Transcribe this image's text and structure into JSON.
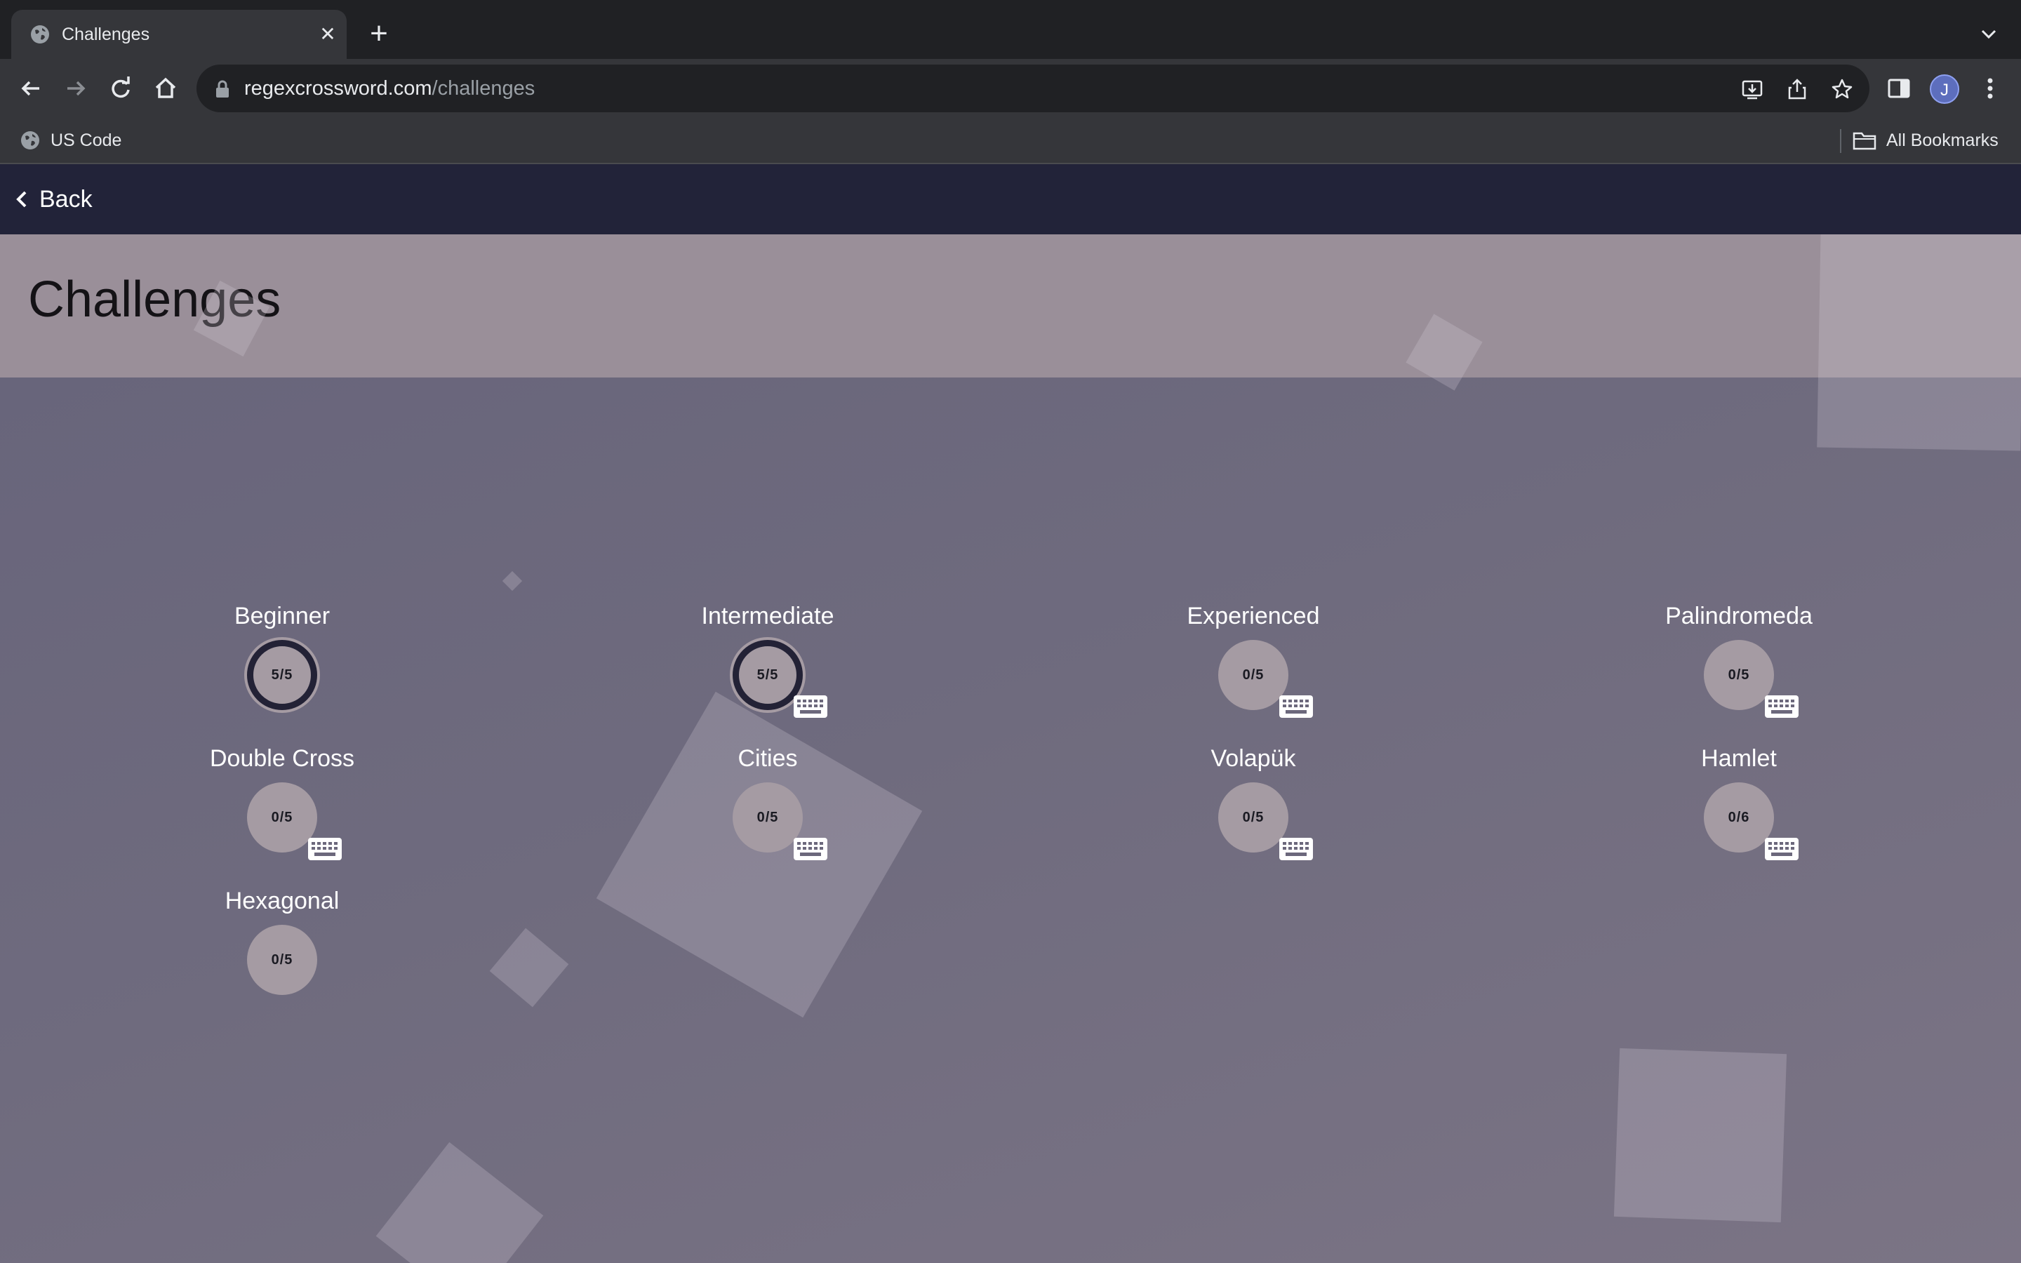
{
  "browser": {
    "tab_title": "Challenges",
    "url_domain": "regexcrossword.com",
    "url_path": "/challenges",
    "profile_initial": "J",
    "bookmarks": {
      "left_item": "US Code",
      "right_item": "All Bookmarks"
    }
  },
  "page": {
    "back_label": "Back",
    "title": "Challenges"
  },
  "challenges": [
    {
      "name": "Beginner",
      "score": "5/5",
      "completed": true,
      "keyboard": false
    },
    {
      "name": "Intermediate",
      "score": "5/5",
      "completed": true,
      "keyboard": true
    },
    {
      "name": "Experienced",
      "score": "0/5",
      "completed": false,
      "keyboard": true
    },
    {
      "name": "Palindromeda",
      "score": "0/5",
      "completed": false,
      "keyboard": true
    },
    {
      "name": "Double Cross",
      "score": "0/5",
      "completed": false,
      "keyboard": true
    },
    {
      "name": "Cities",
      "score": "0/5",
      "completed": false,
      "keyboard": true
    },
    {
      "name": "Volapük",
      "score": "0/5",
      "completed": false,
      "keyboard": true
    },
    {
      "name": "Hamlet",
      "score": "0/6",
      "completed": false,
      "keyboard": true
    },
    {
      "name": "Hexagonal",
      "score": "0/5",
      "completed": false,
      "keyboard": false
    }
  ],
  "colors": {
    "topbar": "#222339",
    "header_band": "#9a8f99",
    "circle": "#a59ba3",
    "ring_done": "#232236"
  }
}
